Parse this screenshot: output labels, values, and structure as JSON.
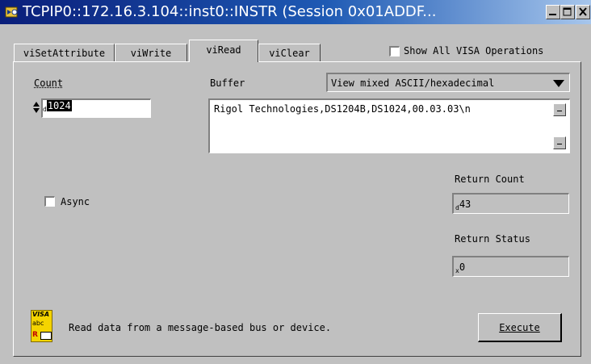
{
  "window": {
    "title": "TCPIP0::172.16.3.104::inst0::INSTR (Session 0x01ADDF..."
  },
  "tabs": [
    {
      "label": "viSetAttribute"
    },
    {
      "label": "viWrite"
    },
    {
      "label": "viRead"
    },
    {
      "label": "viClear"
    }
  ],
  "active_tab": "viRead",
  "show_all_ops": {
    "label": "Show All VISA Operations",
    "checked": false
  },
  "count": {
    "label": "Count",
    "radix": "d",
    "value": "1024"
  },
  "buffer": {
    "label": "Buffer",
    "mode": "View mixed ASCII/hexadecimal",
    "content": "Rigol Technologies,DS1204B,DS1024,00.03.03\\n"
  },
  "async": {
    "label": "Async",
    "checked": false
  },
  "return_count": {
    "label": "Return Count",
    "radix": "d",
    "value": "43"
  },
  "return_status": {
    "label": "Return Status",
    "radix": "x",
    "value": "0"
  },
  "visa_badge": {
    "line1": "VISA",
    "line2": "abc",
    "line3": "R"
  },
  "description": "Read data from a message-based bus or device.",
  "execute": {
    "label": "Execute"
  }
}
